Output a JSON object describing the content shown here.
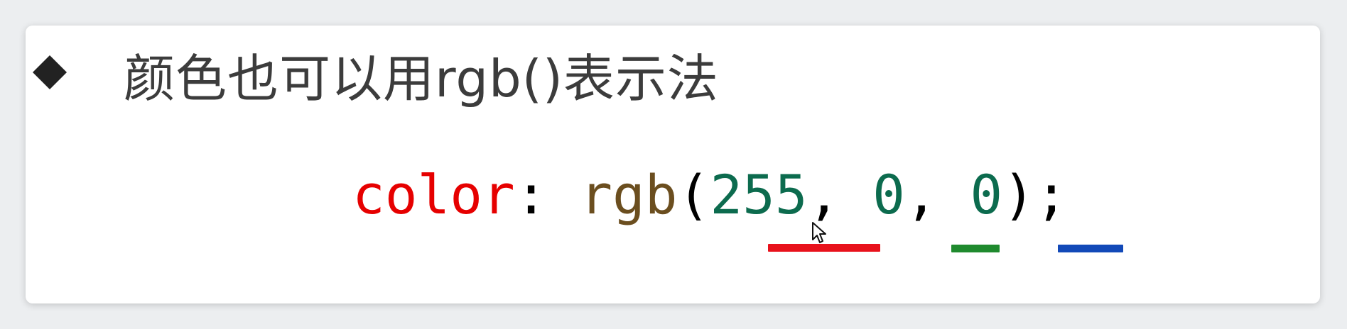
{
  "heading": {
    "bullet_icon": "diamond-bullet-icon",
    "text": "颜色也可以用rgb()表示法"
  },
  "code": {
    "property": "color",
    "colon": ": ",
    "function": "rgb",
    "open_paren": "(",
    "red_value": "255",
    "comma1": ", ",
    "green_value": "0",
    "comma2": ", ",
    "blue_value": "0",
    "close": ");"
  },
  "colors": {
    "background": "#eceef0",
    "slide": "#ffffff",
    "heading_text": "#3c3c3c",
    "bullet": "#222222",
    "property": "#e60000",
    "function": "#6b4e1f",
    "number": "#0c6b4e",
    "underline_red": "#e8121c",
    "underline_green": "#1f8a2e",
    "underline_blue": "#1249b8"
  }
}
